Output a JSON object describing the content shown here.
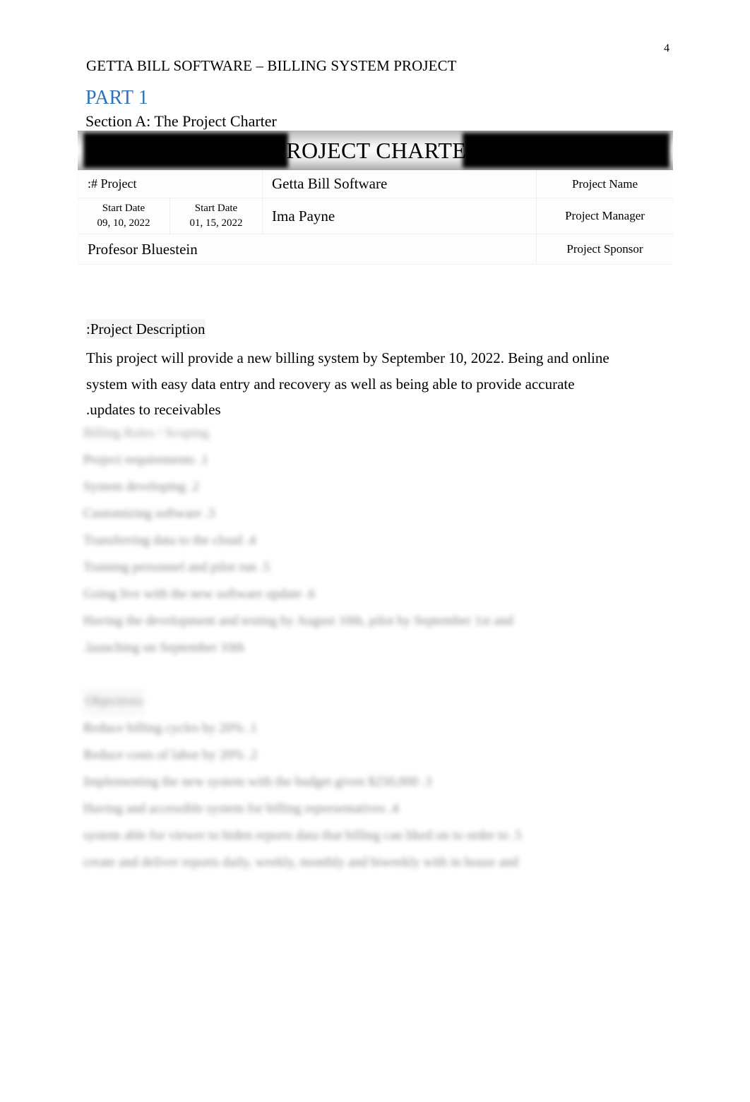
{
  "page": {
    "number": "4",
    "running_header": "GETTA BILL SOFTWARE – BILLING SYSTEM PROJECT"
  },
  "headings": {
    "part": "PART 1",
    "part_color": "#2E74B5",
    "section": "Section A: The Project Charter"
  },
  "charter": {
    "title": "PROJECT CHARTER",
    "title_redacted": true,
    "rows": [
      {
        "left_label": ":#   Project",
        "value": "Getta Bill Software",
        "role": "Project Name"
      },
      {
        "dates": [
          {
            "label": "Start Date",
            "value": "09, 10, 2022"
          },
          {
            "label": "Start Date",
            "value": "01, 15, 2022"
          }
        ],
        "value": "Ima Payne",
        "role": "Project Manager"
      },
      {
        "value": "Profesor Bluestein",
        "role": "Project Sponsor"
      }
    ]
  },
  "description": {
    "label": ":Project Description",
    "lines": [
      "This project will provide a new billing system by September 10, 2022. Being and online",
      "system with easy data entry and recovery as well as being able to provide accurate",
      " .updates to receivables"
    ]
  },
  "obscured_block_1": {
    "note": "blurred illegible text",
    "lines": [
      "Billing Roles / Scoping",
      "Project requirements      .1",
      "System developing       .2",
      "Customizing software       .3",
      "Transferring data to the cloud      .4",
      "Training personnel and pilot run       .5",
      " Going live with the new software update        .6",
      "Having the development and testing by August 10th, pilot by September 1st and",
      " .launching on September 10th"
    ]
  },
  "obscured_block_2": {
    "note": "blurred illegible text",
    "heading": "Objectives",
    "lines": [
      "Reduce billing cycles by 20%   .1",
      "Reduce costs of labor by 20%   .2",
      "Implementing the new system with the budget given  $250,000    .3",
      "Having and accessible system for billing representatives    .4",
      "system able for viewer to  hiden reports data that billing can liked on to order to   .5",
      "create and deliver reports daily, weekly, monthly and biweekly with in house and"
    ]
  }
}
